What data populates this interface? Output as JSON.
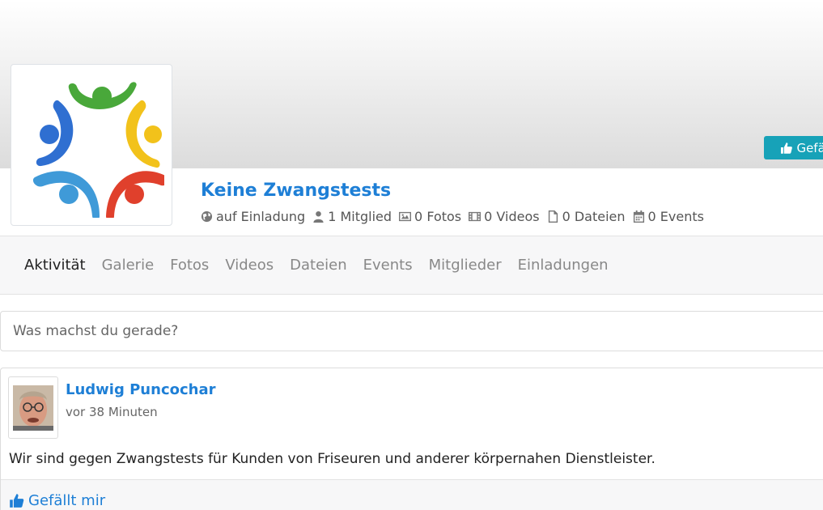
{
  "cover": {
    "like_button_label": "Gefällt"
  },
  "group": {
    "title": "Keine Zwangstests",
    "meta": [
      {
        "icon": "globe-icon",
        "text": "auf Einladung"
      },
      {
        "icon": "user-icon",
        "text": "1 Mitglied"
      },
      {
        "icon": "image-icon",
        "text": "0 Fotos"
      },
      {
        "icon": "film-icon",
        "text": "0 Videos"
      },
      {
        "icon": "file-icon",
        "text": "0 Dateien"
      },
      {
        "icon": "calendar-icon",
        "text": "0 Events"
      }
    ]
  },
  "nav": {
    "items": [
      {
        "label": "Aktivität",
        "active": true
      },
      {
        "label": "Galerie"
      },
      {
        "label": "Fotos"
      },
      {
        "label": "Videos"
      },
      {
        "label": "Dateien"
      },
      {
        "label": "Events"
      },
      {
        "label": "Mitglieder"
      },
      {
        "label": "Einladungen"
      }
    ]
  },
  "composer": {
    "placeholder": "Was machst du gerade?"
  },
  "post": {
    "author": "Ludwig Puncochar",
    "time": "vor 38 Minuten",
    "text": "Wir sind gegen Zwangstests für Kunden von Friseuren und anderer körpernahen Dienstleister.",
    "like_label": "Gefällt mir"
  },
  "colors": {
    "accent": "#1e7fd6",
    "teal_button": "#17a2b8",
    "logo_blue": "#2f6fd1",
    "logo_green": "#49a83a",
    "logo_yellow": "#f2c21b",
    "logo_red": "#e0402c",
    "logo_lightblue": "#3f9ad8"
  }
}
